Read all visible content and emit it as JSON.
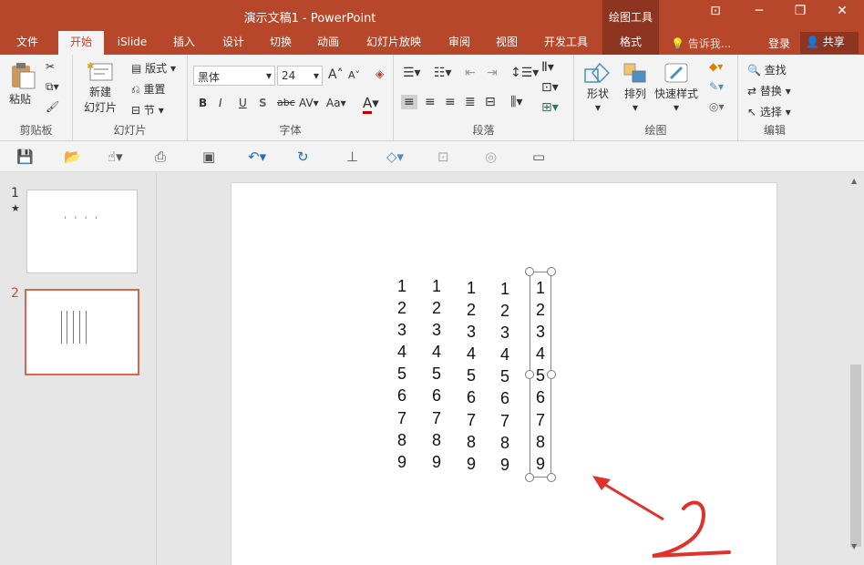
{
  "window": {
    "title": "演示文稿1 - PowerPoint",
    "context_tab": "绘图工具",
    "minimize": "─",
    "restore": "❐",
    "close": "✕",
    "ribbon_display": "⊡"
  },
  "tabs": [
    "文件",
    "开始",
    "iSlide",
    "插入",
    "设计",
    "切换",
    "动画",
    "幻灯片放映",
    "审阅",
    "视图",
    "开发工具",
    "格式"
  ],
  "tell_me": "告诉我...",
  "login": "登录",
  "share": "共享",
  "ribbon": {
    "clipboard": {
      "name": "剪贴板",
      "paste": "粘贴"
    },
    "slides": {
      "name": "幻灯片",
      "new_slide_1": "新建",
      "new_slide_2": "幻灯片",
      "layout": "版式",
      "reset": "重置",
      "section": "节"
    },
    "font": {
      "name": "字体",
      "font_name": "黑体",
      "font_size": "24",
      "bold": "B",
      "italic": "I",
      "underline": "U",
      "shadow": "S",
      "strike": "abc",
      "spacing": "AV",
      "case": "Aa",
      "color": "A",
      "grow": "A",
      "shrink": "A"
    },
    "paragraph": {
      "name": "段落"
    },
    "drawing": {
      "name": "绘图",
      "shapes": "形状",
      "arrange": "排列",
      "quick_styles": "快速样式"
    },
    "editing": {
      "name": "编辑",
      "find": "查找",
      "replace": "替换",
      "select": "选择"
    }
  },
  "thumbnails": [
    {
      "number": "1",
      "star": "★",
      "preview": "' ' ' '"
    },
    {
      "number": "2",
      "star": "",
      "preview": ""
    }
  ],
  "slide_columns": [
    [
      "1",
      "2",
      "3",
      "4",
      "5",
      "6",
      "7",
      "8",
      "9"
    ],
    [
      "1",
      "2",
      "3",
      "4",
      "5",
      "6",
      "7",
      "8",
      "9"
    ],
    [
      "1",
      "2",
      "3",
      "4",
      "5",
      "6",
      "7",
      "8",
      "9"
    ],
    [
      "1",
      "2",
      "3",
      "4",
      "5",
      "6",
      "7",
      "8",
      "9"
    ],
    [
      "1",
      "2",
      "3",
      "4",
      "5",
      "6",
      "7",
      "8",
      "9"
    ]
  ],
  "annotation": {
    "number": "2",
    "color": "#e0322a"
  },
  "colors": {
    "accent": "#b7472a",
    "accent_dark": "#8e3521",
    "font_color_bar": "#c00000"
  }
}
